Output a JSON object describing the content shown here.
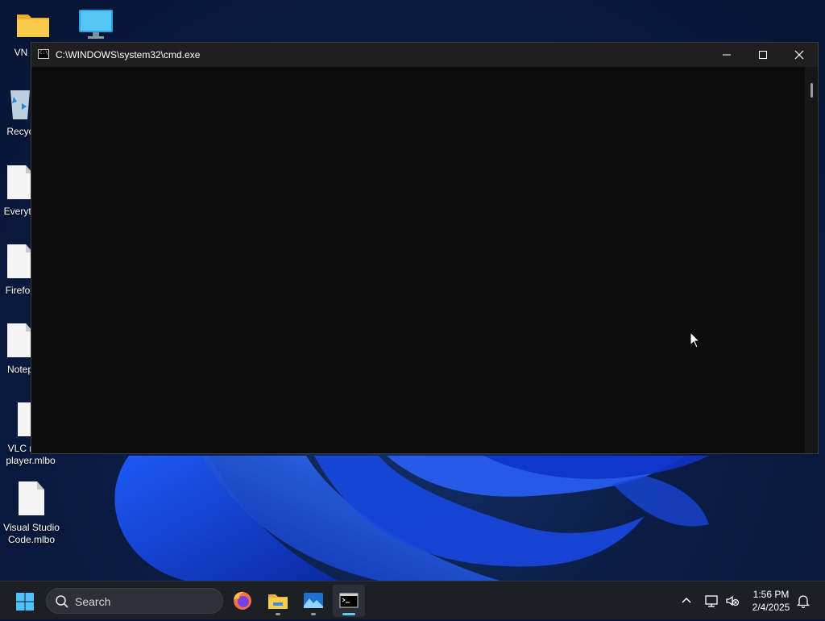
{
  "desktop": {
    "icons": [
      {
        "label": "VN",
        "kind": "folder"
      },
      {
        "label": "",
        "kind": "monitor"
      },
      {
        "label": "Recyc",
        "kind": "recycle-bin"
      },
      {
        "label": "Everyth",
        "kind": "file"
      },
      {
        "label": "Firefox",
        "kind": "file"
      },
      {
        "label": "Notep",
        "kind": "file"
      },
      {
        "label": "VLC r",
        "label2": "player.mlbo",
        "kind": "file"
      },
      {
        "label": "Visual Studio",
        "label2": "Code.mlbo",
        "kind": "file"
      }
    ]
  },
  "cmd": {
    "title": "C:\\WINDOWS\\system32\\cmd.exe",
    "icon_text": "C:\\",
    "buttons": {
      "minimize": "minimize-icon",
      "maximize": "maximize-icon",
      "close": "close-icon"
    },
    "content": ""
  },
  "taskbar": {
    "search_placeholder": "Search",
    "apps": [
      "firefox",
      "file-explorer",
      "photos",
      "command-prompt"
    ],
    "time": "1:56 PM",
    "date": "2/4/2025"
  },
  "colors": {
    "console_bg": "#0c0c0c",
    "titlebar_bg": "#1f1f1f",
    "taskbar_bg": "#1c1f26",
    "accent": "#60cdff"
  }
}
